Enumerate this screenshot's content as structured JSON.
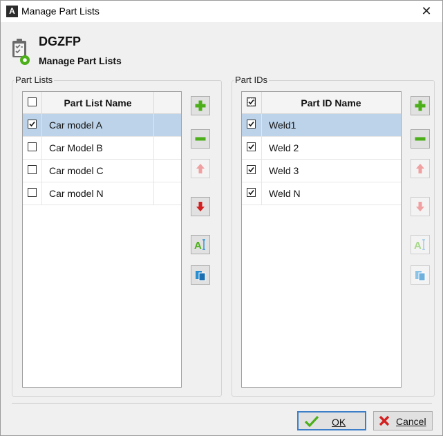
{
  "window": {
    "title": "Manage Part Lists",
    "app_icon": "A",
    "close_glyph": "✕"
  },
  "header": {
    "app_name": "DGZFP",
    "subtitle": "Manage Part Lists"
  },
  "part_lists": {
    "group_label": "Part Lists",
    "column_header": "Part List Name",
    "rows": [
      {
        "name": "Car model A",
        "checked": true,
        "selected": true
      },
      {
        "name": "Car Model B",
        "checked": false,
        "selected": false
      },
      {
        "name": "Car model C",
        "checked": false,
        "selected": false
      },
      {
        "name": "Car model N",
        "checked": false,
        "selected": false
      }
    ],
    "buttons": {
      "add": {
        "icon": "plus-icon",
        "enabled": true
      },
      "remove": {
        "icon": "minus-icon",
        "enabled": true
      },
      "move_up": {
        "icon": "arrow-up-icon",
        "enabled": false
      },
      "move_down": {
        "icon": "arrow-down-icon",
        "enabled": true
      },
      "rename": {
        "icon": "rename-icon",
        "enabled": true
      },
      "copy": {
        "icon": "copy-icon",
        "enabled": true
      }
    }
  },
  "part_ids": {
    "group_label": "Part IDs",
    "column_header": "Part ID Name",
    "header_checkbox": "indeterminate",
    "rows": [
      {
        "name": "Weld1",
        "checked": true,
        "selected": true
      },
      {
        "name": "Weld 2",
        "checked": true,
        "selected": false
      },
      {
        "name": "Weld 3",
        "checked": true,
        "selected": false
      },
      {
        "name": "Weld N",
        "checked": true,
        "selected": false
      }
    ],
    "buttons": {
      "add": {
        "icon": "plus-icon",
        "enabled": true
      },
      "remove": {
        "icon": "minus-icon",
        "enabled": true
      },
      "move_up": {
        "icon": "arrow-up-icon",
        "enabled": false
      },
      "move_down": {
        "icon": "arrow-down-icon",
        "enabled": false
      },
      "rename": {
        "icon": "rename-icon",
        "enabled": false
      },
      "copy": {
        "icon": "copy-icon",
        "enabled": false
      }
    }
  },
  "footer": {
    "ok_label": "OK",
    "cancel_label": "Cancel"
  },
  "colors": {
    "selection": "#bcd3e9",
    "green": "#4caf1a",
    "red": "#d42020",
    "blue": "#2a8fd0",
    "primary_border": "#3c7fc8"
  }
}
